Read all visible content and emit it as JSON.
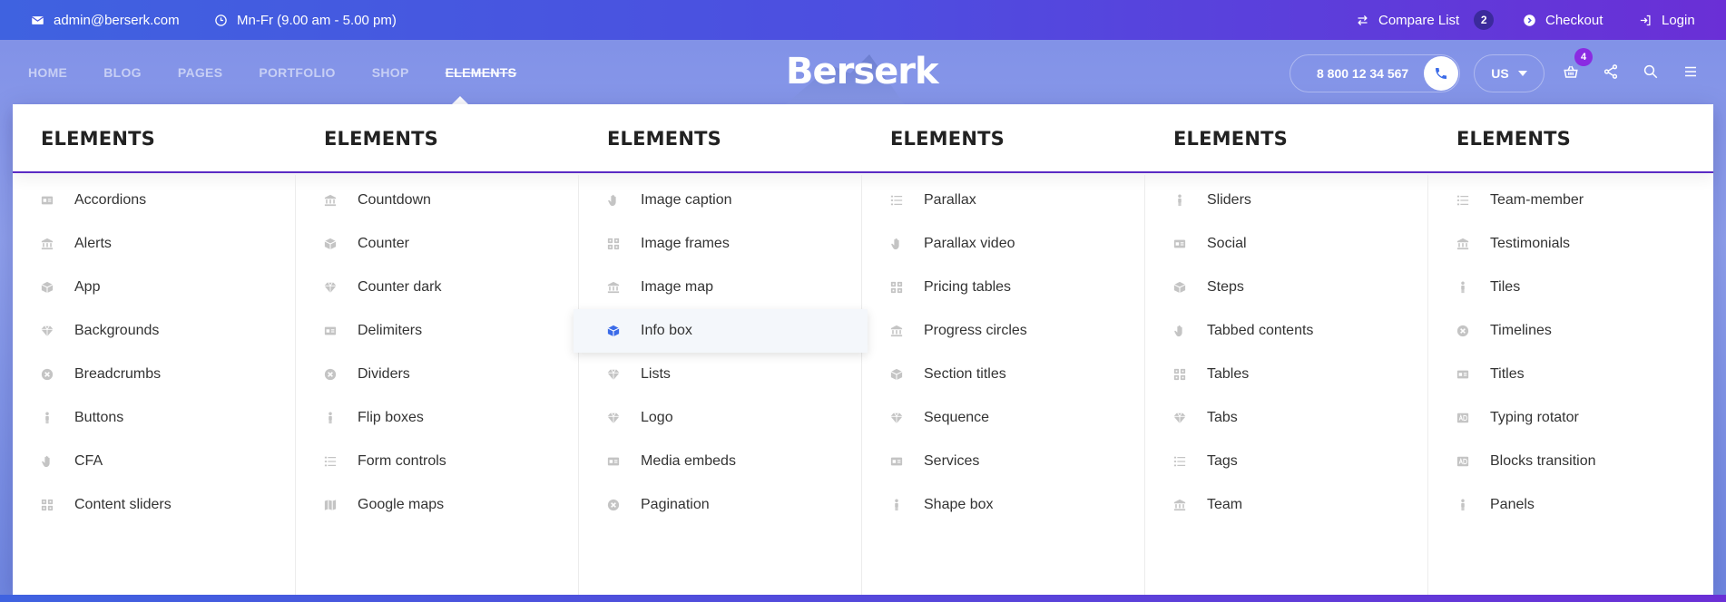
{
  "topbar": {
    "email": "admin@berserk.com",
    "hours": "Mn-Fr (9.00 am - 5.00 pm)",
    "compare_label": "Compare List",
    "compare_count": "2",
    "checkout_label": "Checkout",
    "login_label": "Login"
  },
  "nav": {
    "items": [
      "HOME",
      "BLOG",
      "PAGES",
      "PORTFOLIO",
      "SHOP",
      "ELEMENTS"
    ],
    "active": "ELEMENTS"
  },
  "brand": {
    "logo": "Berserk"
  },
  "header": {
    "phone": "8 800 12 34 567",
    "language": "US",
    "cart_count": "4"
  },
  "mega_menu": {
    "columns": [
      {
        "title": "ELEMENTS",
        "items": [
          {
            "label": "Accordions",
            "icon": "id-card-icon"
          },
          {
            "label": "Alerts",
            "icon": "bank-icon"
          },
          {
            "label": "App",
            "icon": "cube-icon"
          },
          {
            "label": "Backgrounds",
            "icon": "diamond-icon"
          },
          {
            "label": "Breadcrumbs",
            "icon": "x-circle-icon"
          },
          {
            "label": "Buttons",
            "icon": "person-icon"
          },
          {
            "label": "CFA",
            "icon": "hand-icon"
          },
          {
            "label": "Content sliders",
            "icon": "grid-icon"
          }
        ]
      },
      {
        "title": "ELEMENTS",
        "items": [
          {
            "label": "Countdown",
            "icon": "bank-icon"
          },
          {
            "label": "Counter",
            "icon": "cube-icon"
          },
          {
            "label": "Counter dark",
            "icon": "diamond-icon"
          },
          {
            "label": "Delimiters",
            "icon": "id-card-icon"
          },
          {
            "label": "Dividers",
            "icon": "x-circle-icon"
          },
          {
            "label": "Flip boxes",
            "icon": "person-icon"
          },
          {
            "label": "Form controls",
            "icon": "list-icon"
          },
          {
            "label": "Google maps",
            "icon": "map-icon"
          }
        ]
      },
      {
        "title": "ELEMENTS",
        "items": [
          {
            "label": "Image caption",
            "icon": "hand-icon"
          },
          {
            "label": "Image frames",
            "icon": "grid-icon"
          },
          {
            "label": "Image map",
            "icon": "bank-icon"
          },
          {
            "label": "Info box",
            "icon": "cube-icon",
            "highlighted": true
          },
          {
            "label": "Lists",
            "icon": "diamond-icon"
          },
          {
            "label": "Logo",
            "icon": "diamond-icon"
          },
          {
            "label": "Media embeds",
            "icon": "id-card-icon"
          },
          {
            "label": "Pagination",
            "icon": "x-circle-icon"
          }
        ]
      },
      {
        "title": "ELEMENTS",
        "items": [
          {
            "label": "Parallax",
            "icon": "list-icon"
          },
          {
            "label": "Parallax video",
            "icon": "hand-icon"
          },
          {
            "label": "Pricing tables",
            "icon": "grid-icon"
          },
          {
            "label": "Progress circles",
            "icon": "bank-icon"
          },
          {
            "label": "Section titles",
            "icon": "cube-icon"
          },
          {
            "label": "Sequence",
            "icon": "diamond-icon"
          },
          {
            "label": "Services",
            "icon": "id-card-icon"
          },
          {
            "label": "Shape box",
            "icon": "person-icon"
          }
        ]
      },
      {
        "title": "ELEMENTS",
        "items": [
          {
            "label": "Sliders",
            "icon": "person-icon"
          },
          {
            "label": "Social",
            "icon": "id-card-icon"
          },
          {
            "label": "Steps",
            "icon": "cube-icon"
          },
          {
            "label": "Tabbed contents",
            "icon": "hand-icon"
          },
          {
            "label": "Tables",
            "icon": "grid-icon"
          },
          {
            "label": "Tabs",
            "icon": "diamond-icon"
          },
          {
            "label": "Tags",
            "icon": "list-icon"
          },
          {
            "label": "Team",
            "icon": "bank-icon"
          }
        ]
      },
      {
        "title": "ELEMENTS",
        "items": [
          {
            "label": "Team-member",
            "icon": "list-icon"
          },
          {
            "label": "Testimonials",
            "icon": "bank-icon"
          },
          {
            "label": "Tiles",
            "icon": "person-icon"
          },
          {
            "label": "Timelines",
            "icon": "x-circle-icon"
          },
          {
            "label": "Titles",
            "icon": "id-card-icon"
          },
          {
            "label": "Typing rotator",
            "icon": "ad-icon"
          },
          {
            "label": "Blocks transition",
            "icon": "ad-icon"
          },
          {
            "label": "Panels",
            "icon": "person-icon"
          }
        ]
      }
    ]
  },
  "colors": {
    "accent": "#3b6be8",
    "menu_underline": "#5a2bc4",
    "badge": "#8a2be2"
  }
}
